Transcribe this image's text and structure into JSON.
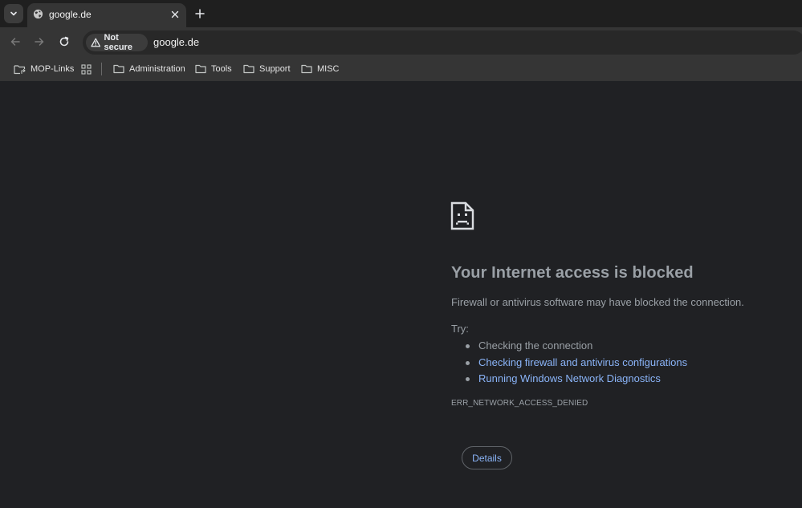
{
  "tab": {
    "title": "google.de",
    "favicon_icon": "globe-icon"
  },
  "toolbar": {
    "security_label": "Not secure",
    "url": "google.de"
  },
  "bookmarks": [
    {
      "label": "MOP-Links",
      "icon": "folder-link-icon"
    },
    {
      "label": "",
      "icon": "apps-grid-icon"
    },
    {
      "label": "Administration",
      "icon": "folder-icon"
    },
    {
      "label": "Tools",
      "icon": "folder-icon"
    },
    {
      "label": "Support",
      "icon": "folder-icon"
    },
    {
      "label": "MISC",
      "icon": "folder-icon"
    }
  ],
  "error": {
    "icon": "sad-page-icon",
    "title": "Your Internet access is blocked",
    "description": "Firewall or antivirus software may have blocked the connection.",
    "try_label": "Try:",
    "suggestions": [
      {
        "text": "Checking the connection",
        "link": false
      },
      {
        "text": "Checking firewall and antivirus configurations",
        "link": true
      },
      {
        "text": "Running Windows Network Diagnostics",
        "link": true
      }
    ],
    "code": "ERR_NETWORK_ACCESS_DENIED",
    "details_button": "Details"
  },
  "colors": {
    "page_bg": "#202124",
    "toolbar_bg": "#353535",
    "link": "#8ab4f8",
    "muted_text": "#9aa0a6"
  }
}
